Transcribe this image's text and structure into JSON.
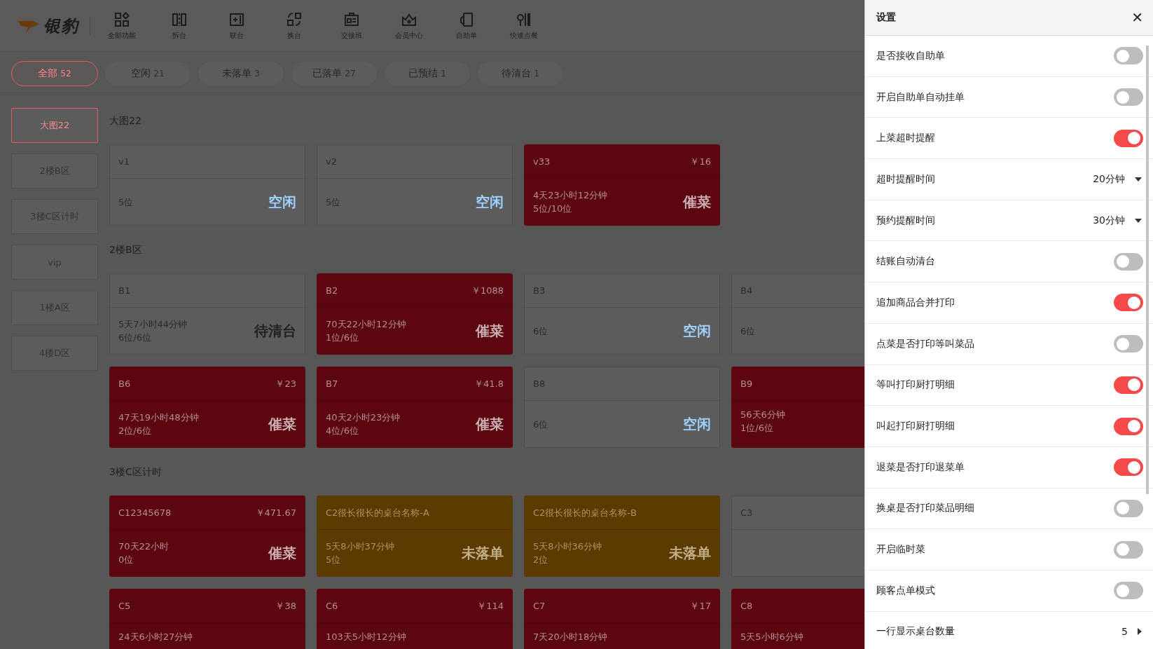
{
  "logo": {
    "text": "银豹"
  },
  "toolbar": [
    {
      "label": "全部功能"
    },
    {
      "label": "拆台"
    },
    {
      "label": "联台"
    },
    {
      "label": "换台"
    },
    {
      "label": "交接班"
    },
    {
      "label": "会员中心"
    },
    {
      "label": "自助单"
    },
    {
      "label": "快速点餐"
    }
  ],
  "filters": [
    {
      "label": "全部",
      "count": "52",
      "selected": true
    },
    {
      "label": "空闲",
      "count": "21",
      "selected": false
    },
    {
      "label": "未落单",
      "count": "3",
      "selected": false
    },
    {
      "label": "已落单",
      "count": "27",
      "selected": false
    },
    {
      "label": "已预结",
      "count": "1",
      "selected": false
    },
    {
      "label": "待清台",
      "count": "1",
      "selected": false
    }
  ],
  "areas": [
    {
      "label": "大图22",
      "selected": true
    },
    {
      "label": "2楼B区",
      "selected": false
    },
    {
      "label": "3楼C区计时",
      "selected": false
    },
    {
      "label": "vip",
      "selected": false
    },
    {
      "label": "1楼A区",
      "selected": false
    },
    {
      "label": "4楼D区",
      "selected": false
    }
  ],
  "sections": [
    {
      "title": "大图22",
      "tables": [
        {
          "kind": "idle",
          "name": "v1",
          "lines": [
            "5位"
          ],
          "status": "空闲"
        },
        {
          "kind": "idle",
          "name": "v2",
          "lines": [
            "5位"
          ],
          "status": "空闲"
        },
        {
          "kind": "urging",
          "name": "v33",
          "price": "￥16",
          "lines": [
            "4天23小时12分钟",
            "5位/10位"
          ],
          "status": "催菜"
        }
      ]
    },
    {
      "title": "2楼B区",
      "tables": [
        {
          "kind": "cleanup",
          "name": "B1",
          "lines": [
            "5天7小时44分钟",
            "6位/6位"
          ],
          "status": "待清台"
        },
        {
          "kind": "urging",
          "name": "B2",
          "price": "￥1088",
          "lines": [
            "70天22小时12分钟",
            "1位/6位"
          ],
          "status": "催菜"
        },
        {
          "kind": "idle",
          "name": "B3",
          "lines": [
            "6位"
          ],
          "status": "空闲"
        },
        {
          "kind": "idle",
          "name": "B4",
          "lines": [
            "6位"
          ]
        },
        {
          "kind": "urging",
          "name": "B6",
          "price": "￥23",
          "lines": [
            "47天19小时48分钟",
            "2位/6位"
          ],
          "status": "催菜"
        },
        {
          "kind": "urging",
          "name": "B7",
          "price": "￥41.8",
          "lines": [
            "40天2小时23分钟",
            "4位/6位"
          ],
          "status": "催菜"
        },
        {
          "kind": "idle",
          "name": "B8",
          "lines": [
            "6位"
          ],
          "status": "空闲"
        },
        {
          "kind": "urging",
          "name": "B9",
          "lines": [
            "56天6分钟",
            "1位/6位"
          ]
        }
      ]
    },
    {
      "title": "3楼C区计时",
      "tables": [
        {
          "kind": "urging",
          "name": "C12345678",
          "price": "￥471.67",
          "lines": [
            "70天22小时",
            "0位"
          ],
          "status": "催菜"
        },
        {
          "kind": "pending",
          "name": "C2很长很长的桌台名称-A",
          "lines": [
            "5天8小时37分钟",
            "5位"
          ],
          "status": "未落单"
        },
        {
          "kind": "pending",
          "name": "C2很长很长的桌台名称-B",
          "lines": [
            "5天8小时36分钟",
            "2位"
          ],
          "status": "未落单"
        },
        {
          "kind": "idle",
          "name": "C3"
        },
        {
          "kind": "urging",
          "name": "C5",
          "price": "￥38",
          "lines": [
            "24天6小时27分钟"
          ]
        },
        {
          "kind": "urging",
          "name": "C6",
          "price": "￥114",
          "lines": [
            "103天5小时12分钟"
          ]
        },
        {
          "kind": "urging",
          "name": "C7",
          "price": "￥17",
          "lines": [
            "7天20小时18分钟"
          ]
        },
        {
          "kind": "urging",
          "name": "C8",
          "lines": [
            "5天5小时6分钟"
          ]
        }
      ]
    }
  ],
  "settings": {
    "title": "设置",
    "close": "✕",
    "rows": [
      {
        "kind": "toggle",
        "label": "是否接收自助单",
        "on": false
      },
      {
        "kind": "toggle",
        "label": "开启自助单自动挂单",
        "on": false
      },
      {
        "kind": "toggle",
        "label": "上菜超时提醒",
        "on": true
      },
      {
        "kind": "select",
        "label": "超时提醒时间",
        "value": "20分钟"
      },
      {
        "kind": "select",
        "label": "预约提醒时间",
        "value": "30分钟"
      },
      {
        "kind": "toggle",
        "label": "结账自动清台",
        "on": false
      },
      {
        "kind": "toggle",
        "label": "追加商品合并打印",
        "on": true
      },
      {
        "kind": "toggle",
        "label": "点菜是否打印等叫菜品",
        "on": false
      },
      {
        "kind": "toggle",
        "label": "等叫打印厨打明细",
        "on": true
      },
      {
        "kind": "toggle",
        "label": "叫起打印厨打明细",
        "on": true
      },
      {
        "kind": "toggle",
        "label": "退菜是否打印退菜单",
        "on": true
      },
      {
        "kind": "toggle",
        "label": "换桌是否打印菜品明细",
        "on": false
      },
      {
        "kind": "toggle",
        "label": "开启临时菜",
        "on": false
      },
      {
        "kind": "toggle",
        "label": "顾客点单模式",
        "on": false
      },
      {
        "kind": "stepper",
        "label": "一行显示桌台数量",
        "value": "5"
      }
    ]
  }
}
